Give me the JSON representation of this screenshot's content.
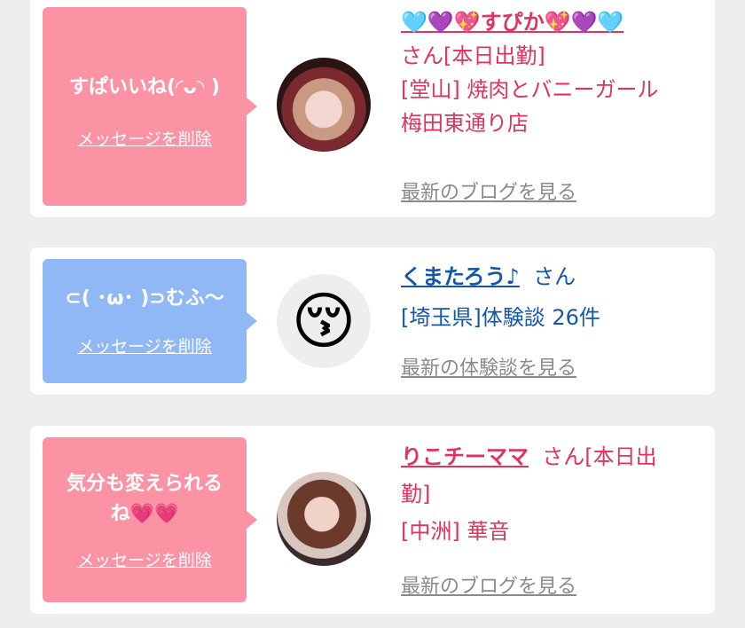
{
  "cards": [
    {
      "message": "すぱいいね(◜ᴗ◝ )",
      "delete_label": "メッセージを削除",
      "name": "🩵💜💖すぴか💖💜🩵",
      "san": "さん",
      "status": "[本日出勤]",
      "shop_line1": "[堂山] 焼肉とバニーガール",
      "shop_line2": "梅田東通り店",
      "link": "最新のブログを見る"
    },
    {
      "message": "⊂( ･ω･ )⊃むふ〜",
      "delete_label": "メッセージを削除",
      "name": "くまたろう♪",
      "san": "さん",
      "detail": "[埼玉県]体験談 26件",
      "emoji": "😚",
      "link": "最新の体験談を見る"
    },
    {
      "message_line1": "気分も変えられる",
      "message_line2": "ね💗💗",
      "delete_label": "メッセージを削除",
      "name": "りこチーママ",
      "san_status_1": "さん[本日出",
      "san_status_2": "勤]",
      "shop": "[中洲] 華音",
      "link": "最新のブログを見る"
    }
  ]
}
